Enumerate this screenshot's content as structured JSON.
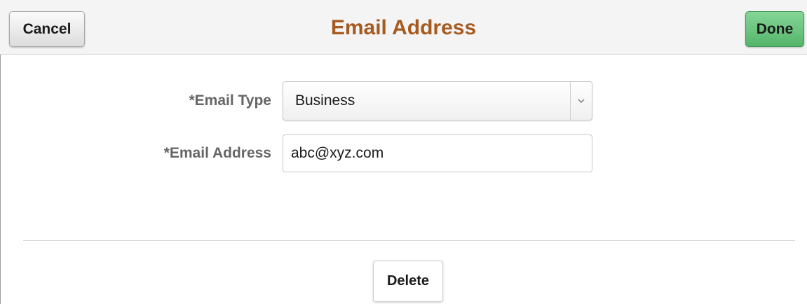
{
  "header": {
    "title": "Email Address",
    "cancel_label": "Cancel",
    "done_label": "Done"
  },
  "form": {
    "email_type": {
      "label": "*Email Type",
      "selected": "Business"
    },
    "email_address": {
      "label": "*Email Address",
      "value": "abc@xyz.com"
    }
  },
  "footer": {
    "delete_label": "Delete"
  },
  "colors": {
    "title": "#a65a20",
    "done_button": "#66c47b",
    "label": "#666666"
  },
  "icons": {
    "select_arrow": "chevron-down-icon"
  }
}
